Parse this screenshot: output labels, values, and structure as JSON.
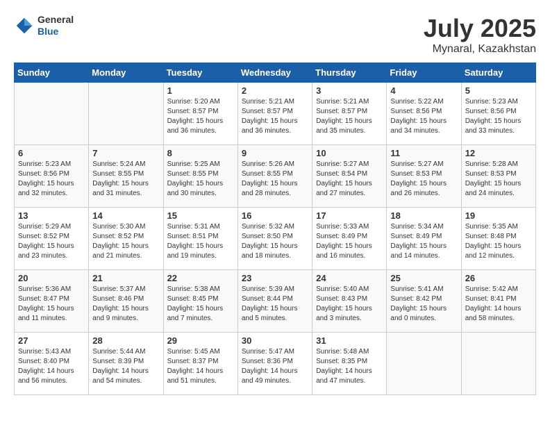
{
  "header": {
    "logo_general": "General",
    "logo_blue": "Blue",
    "month_title": "July 2025",
    "location": "Mynaral, Kazakhstan"
  },
  "days_of_week": [
    "Sunday",
    "Monday",
    "Tuesday",
    "Wednesday",
    "Thursday",
    "Friday",
    "Saturday"
  ],
  "weeks": [
    [
      {
        "day": "",
        "sunrise": "",
        "sunset": "",
        "daylight": ""
      },
      {
        "day": "",
        "sunrise": "",
        "sunset": "",
        "daylight": ""
      },
      {
        "day": "1",
        "sunrise": "Sunrise: 5:20 AM",
        "sunset": "Sunset: 8:57 PM",
        "daylight": "Daylight: 15 hours and 36 minutes."
      },
      {
        "day": "2",
        "sunrise": "Sunrise: 5:21 AM",
        "sunset": "Sunset: 8:57 PM",
        "daylight": "Daylight: 15 hours and 36 minutes."
      },
      {
        "day": "3",
        "sunrise": "Sunrise: 5:21 AM",
        "sunset": "Sunset: 8:57 PM",
        "daylight": "Daylight: 15 hours and 35 minutes."
      },
      {
        "day": "4",
        "sunrise": "Sunrise: 5:22 AM",
        "sunset": "Sunset: 8:56 PM",
        "daylight": "Daylight: 15 hours and 34 minutes."
      },
      {
        "day": "5",
        "sunrise": "Sunrise: 5:23 AM",
        "sunset": "Sunset: 8:56 PM",
        "daylight": "Daylight: 15 hours and 33 minutes."
      }
    ],
    [
      {
        "day": "6",
        "sunrise": "Sunrise: 5:23 AM",
        "sunset": "Sunset: 8:56 PM",
        "daylight": "Daylight: 15 hours and 32 minutes."
      },
      {
        "day": "7",
        "sunrise": "Sunrise: 5:24 AM",
        "sunset": "Sunset: 8:55 PM",
        "daylight": "Daylight: 15 hours and 31 minutes."
      },
      {
        "day": "8",
        "sunrise": "Sunrise: 5:25 AM",
        "sunset": "Sunset: 8:55 PM",
        "daylight": "Daylight: 15 hours and 30 minutes."
      },
      {
        "day": "9",
        "sunrise": "Sunrise: 5:26 AM",
        "sunset": "Sunset: 8:55 PM",
        "daylight": "Daylight: 15 hours and 28 minutes."
      },
      {
        "day": "10",
        "sunrise": "Sunrise: 5:27 AM",
        "sunset": "Sunset: 8:54 PM",
        "daylight": "Daylight: 15 hours and 27 minutes."
      },
      {
        "day": "11",
        "sunrise": "Sunrise: 5:27 AM",
        "sunset": "Sunset: 8:53 PM",
        "daylight": "Daylight: 15 hours and 26 minutes."
      },
      {
        "day": "12",
        "sunrise": "Sunrise: 5:28 AM",
        "sunset": "Sunset: 8:53 PM",
        "daylight": "Daylight: 15 hours and 24 minutes."
      }
    ],
    [
      {
        "day": "13",
        "sunrise": "Sunrise: 5:29 AM",
        "sunset": "Sunset: 8:52 PM",
        "daylight": "Daylight: 15 hours and 23 minutes."
      },
      {
        "day": "14",
        "sunrise": "Sunrise: 5:30 AM",
        "sunset": "Sunset: 8:52 PM",
        "daylight": "Daylight: 15 hours and 21 minutes."
      },
      {
        "day": "15",
        "sunrise": "Sunrise: 5:31 AM",
        "sunset": "Sunset: 8:51 PM",
        "daylight": "Daylight: 15 hours and 19 minutes."
      },
      {
        "day": "16",
        "sunrise": "Sunrise: 5:32 AM",
        "sunset": "Sunset: 8:50 PM",
        "daylight": "Daylight: 15 hours and 18 minutes."
      },
      {
        "day": "17",
        "sunrise": "Sunrise: 5:33 AM",
        "sunset": "Sunset: 8:49 PM",
        "daylight": "Daylight: 15 hours and 16 minutes."
      },
      {
        "day": "18",
        "sunrise": "Sunrise: 5:34 AM",
        "sunset": "Sunset: 8:49 PM",
        "daylight": "Daylight: 15 hours and 14 minutes."
      },
      {
        "day": "19",
        "sunrise": "Sunrise: 5:35 AM",
        "sunset": "Sunset: 8:48 PM",
        "daylight": "Daylight: 15 hours and 12 minutes."
      }
    ],
    [
      {
        "day": "20",
        "sunrise": "Sunrise: 5:36 AM",
        "sunset": "Sunset: 8:47 PM",
        "daylight": "Daylight: 15 hours and 11 minutes."
      },
      {
        "day": "21",
        "sunrise": "Sunrise: 5:37 AM",
        "sunset": "Sunset: 8:46 PM",
        "daylight": "Daylight: 15 hours and 9 minutes."
      },
      {
        "day": "22",
        "sunrise": "Sunrise: 5:38 AM",
        "sunset": "Sunset: 8:45 PM",
        "daylight": "Daylight: 15 hours and 7 minutes."
      },
      {
        "day": "23",
        "sunrise": "Sunrise: 5:39 AM",
        "sunset": "Sunset: 8:44 PM",
        "daylight": "Daylight: 15 hours and 5 minutes."
      },
      {
        "day": "24",
        "sunrise": "Sunrise: 5:40 AM",
        "sunset": "Sunset: 8:43 PM",
        "daylight": "Daylight: 15 hours and 3 minutes."
      },
      {
        "day": "25",
        "sunrise": "Sunrise: 5:41 AM",
        "sunset": "Sunset: 8:42 PM",
        "daylight": "Daylight: 15 hours and 0 minutes."
      },
      {
        "day": "26",
        "sunrise": "Sunrise: 5:42 AM",
        "sunset": "Sunset: 8:41 PM",
        "daylight": "Daylight: 14 hours and 58 minutes."
      }
    ],
    [
      {
        "day": "27",
        "sunrise": "Sunrise: 5:43 AM",
        "sunset": "Sunset: 8:40 PM",
        "daylight": "Daylight: 14 hours and 56 minutes."
      },
      {
        "day": "28",
        "sunrise": "Sunrise: 5:44 AM",
        "sunset": "Sunset: 8:39 PM",
        "daylight": "Daylight: 14 hours and 54 minutes."
      },
      {
        "day": "29",
        "sunrise": "Sunrise: 5:45 AM",
        "sunset": "Sunset: 8:37 PM",
        "daylight": "Daylight: 14 hours and 51 minutes."
      },
      {
        "day": "30",
        "sunrise": "Sunrise: 5:47 AM",
        "sunset": "Sunset: 8:36 PM",
        "daylight": "Daylight: 14 hours and 49 minutes."
      },
      {
        "day": "31",
        "sunrise": "Sunrise: 5:48 AM",
        "sunset": "Sunset: 8:35 PM",
        "daylight": "Daylight: 14 hours and 47 minutes."
      },
      {
        "day": "",
        "sunrise": "",
        "sunset": "",
        "daylight": ""
      },
      {
        "day": "",
        "sunrise": "",
        "sunset": "",
        "daylight": ""
      }
    ]
  ]
}
